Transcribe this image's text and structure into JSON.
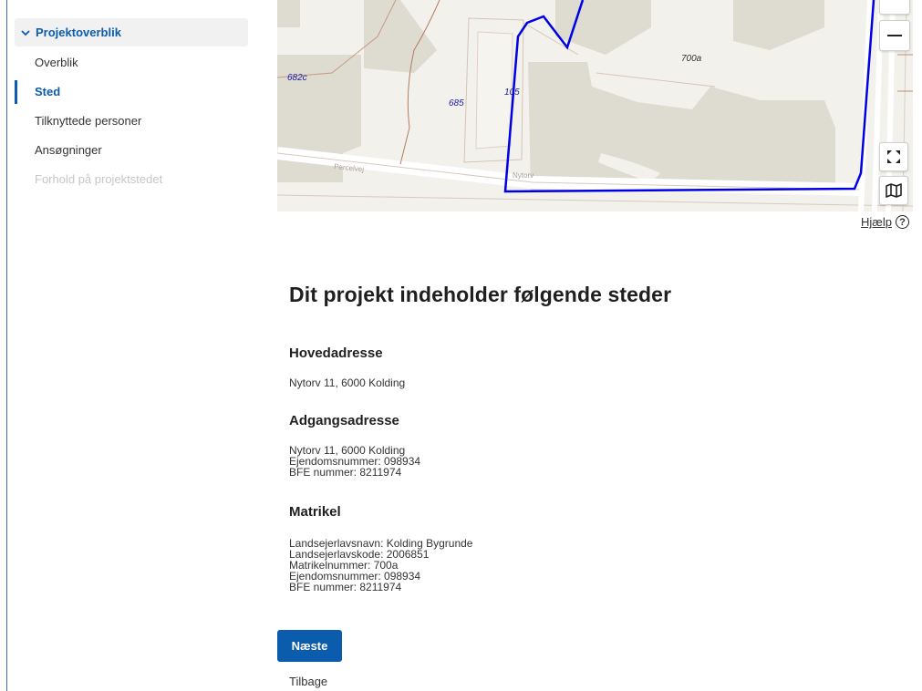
{
  "sidebar": {
    "section_label": "Projektoverblik",
    "items": [
      {
        "label": "Overblik"
      },
      {
        "label": "Sted"
      },
      {
        "label": "Tilknyttede personer"
      },
      {
        "label": "Ansøgninger"
      },
      {
        "label": "Forhold på projektstedet"
      }
    ]
  },
  "map": {
    "labels": {
      "plot_682c": "682c",
      "plot_685": "685",
      "plot_105": "105",
      "plot_700a": "700a",
      "street_1": "Percelvej",
      "street_2": "Nytorv"
    },
    "boundary_color": "#0000e6"
  },
  "help": {
    "label": "Hjælp"
  },
  "main": {
    "title": "Dit projekt indeholder følgende steder",
    "hovedadresse": {
      "title": "Hovedadresse",
      "lines": [
        "Nytorv 11, 6000 Kolding"
      ]
    },
    "adgangsadresse": {
      "title": "Adgangsadresse",
      "lines": [
        "Nytorv 11, 6000 Kolding",
        "Ejendomsnummer: 098934",
        "BFE nummer: 8211974"
      ]
    },
    "matrikel": {
      "title": "Matrikel",
      "lines": [
        "Landsejerlavsnavn: Kolding Bygrunde",
        "Landsejerlavskode: 2006851",
        "Matrikelnummer: 700a",
        "Ejendomsnummer: 098934",
        "BFE nummer: 8211974"
      ]
    }
  },
  "actions": {
    "next_label": "Næste",
    "back_label": "Tilbage"
  },
  "colors": {
    "accent": "#0b5cad"
  }
}
